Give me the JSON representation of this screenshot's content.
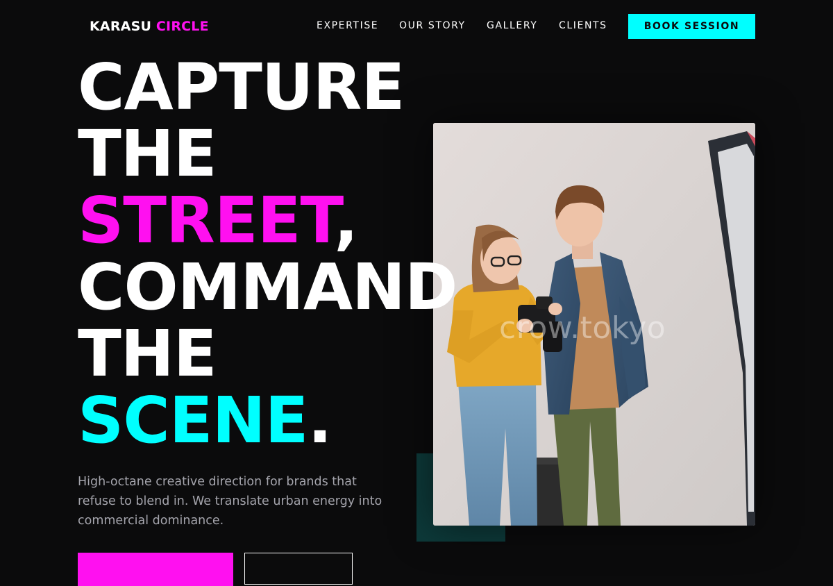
{
  "brand": {
    "logo_word1": "KARASU",
    "logo_word2": "CIRCLE",
    "colors": {
      "magenta": "#ff10f0",
      "cyan": "#00ffff",
      "background": "#0b0b0c",
      "text_muted": "#a4a4ac",
      "accent_teal": "#0d3a3a"
    }
  },
  "nav": {
    "links": [
      "EXPERTISE",
      "OUR STORY",
      "GALLERY",
      "CLIENTS"
    ],
    "cta_label": "BOOK SESSION"
  },
  "hero": {
    "headline": {
      "line1": "CAPTURE",
      "line2": "THE",
      "line3_accent": "STREET",
      "line3_tail": ",",
      "line4": "COMMAND",
      "line5": "THE",
      "line6_accent": "SCENE",
      "line6_tail": "."
    },
    "subcopy": "High-octane creative direction for brands that refuse to blend in. We translate urban energy into commercial dominance.",
    "image": {
      "watermark": "crow.tokyo",
      "subject": "photographer-couple-with-camera"
    }
  }
}
